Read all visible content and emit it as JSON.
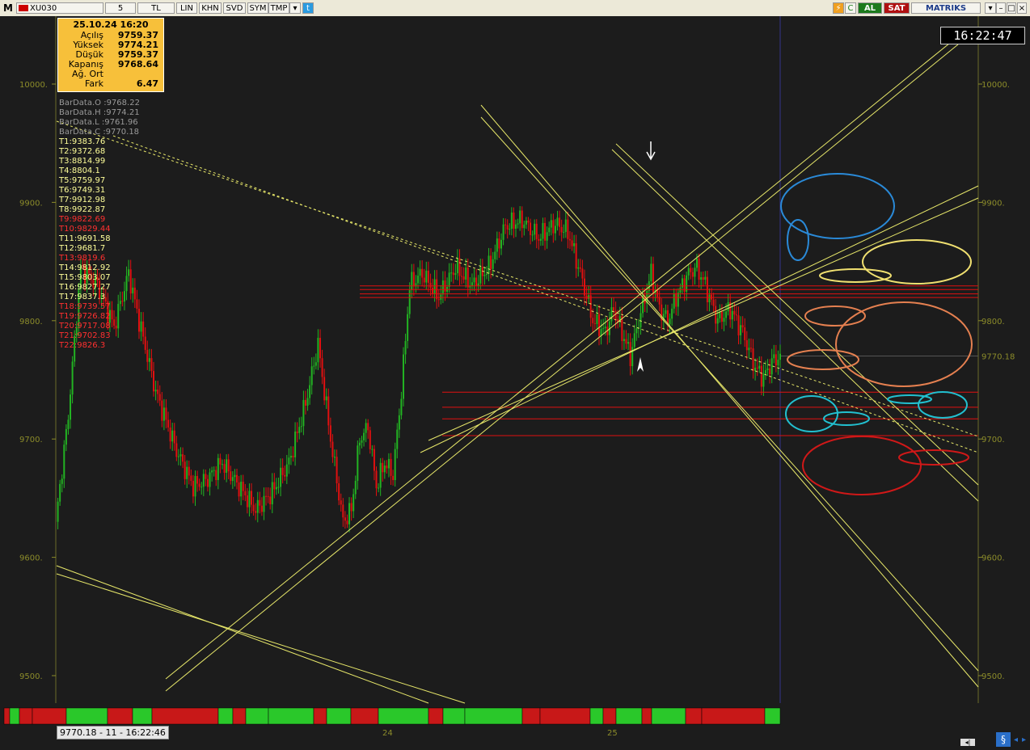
{
  "toolbar": {
    "logo": "M",
    "symbol": "XU030",
    "period": "5",
    "currency": "TL",
    "buttons": [
      "LIN",
      "KHN",
      "SVD",
      "SYM",
      "TMP"
    ],
    "buy_label": "AL",
    "sell_label": "SAT",
    "brand": "MATRIKS"
  },
  "clock": "16:22:47",
  "ohlc": {
    "datetime": "25.10.24 16:20",
    "rows": [
      {
        "label": "Açılış",
        "value": "9759.37"
      },
      {
        "label": "Yüksek",
        "value": "9774.21"
      },
      {
        "label": "Düşük",
        "value": "9759.37"
      },
      {
        "label": "Kapanış",
        "value": "9768.64"
      },
      {
        "label": "Ağ. Ort",
        "value": ""
      },
      {
        "label": "Fark",
        "value": "6.47"
      }
    ]
  },
  "bardata": [
    "BarData.O :9768.22",
    "BarData.H :9774.21",
    "BarData.L :9761.96",
    "BarData.C :9770.18"
  ],
  "levels": [
    {
      "text": "T1:9383.76",
      "color": "#ffff99"
    },
    {
      "text": "T2:9372.68",
      "color": "#ffff99"
    },
    {
      "text": "T3:8814.99",
      "color": "#ffff99"
    },
    {
      "text": "T4:8804.1",
      "color": "#ffff99"
    },
    {
      "text": "T5:9759.97",
      "color": "#ffff99"
    },
    {
      "text": "T6:9749.31",
      "color": "#ffff99"
    },
    {
      "text": "T7:9912.98",
      "color": "#ffff99"
    },
    {
      "text": "T8:9922.87",
      "color": "#ffff99"
    },
    {
      "text": "T9:9822.69",
      "color": "#ff3030"
    },
    {
      "text": "T10:9829.44",
      "color": "#ff3030"
    },
    {
      "text": "T11:9691.58",
      "color": "#ffff99"
    },
    {
      "text": "T12:9681.7",
      "color": "#ffff99"
    },
    {
      "text": "T13:9819.6",
      "color": "#ff3030"
    },
    {
      "text": "T14:9812.92",
      "color": "#ffff99"
    },
    {
      "text": "T15:9803.07",
      "color": "#ffff99"
    },
    {
      "text": "T16:9827.27",
      "color": "#ffff99"
    },
    {
      "text": "T17:9837.3",
      "color": "#ffff99"
    },
    {
      "text": "T18:9739.57",
      "color": "#ff3030"
    },
    {
      "text": "T19:9726.82",
      "color": "#ff3030"
    },
    {
      "text": "T20:9717.08",
      "color": "#ff3030"
    },
    {
      "text": "T21:9702.83",
      "color": "#ff3030"
    },
    {
      "text": "T22:9826.3",
      "color": "#ff3030"
    }
  ],
  "chart_data": {
    "type": "candlestick",
    "yticks": [
      "10000.",
      "9900.",
      "9800.",
      "9700.",
      "9600.",
      "9500."
    ],
    "ytick_values": [
      10000,
      9900,
      9800,
      9700,
      9600,
      9500
    ],
    "ylim": [
      9480,
      10070
    ],
    "last_price_label": "9770.18",
    "last_price": 9770.18,
    "xlabels": [
      "24",
      "25"
    ],
    "close_path": [
      [
        0,
        9630
      ],
      [
        6,
        9720
      ],
      [
        12,
        9845
      ],
      [
        20,
        9830
      ],
      [
        28,
        9795
      ],
      [
        35,
        9840
      ],
      [
        40,
        9800
      ],
      [
        48,
        9740
      ],
      [
        58,
        9690
      ],
      [
        66,
        9660
      ],
      [
        72,
        9665
      ],
      [
        80,
        9680
      ],
      [
        88,
        9660
      ],
      [
        96,
        9640
      ],
      [
        104,
        9655
      ],
      [
        112,
        9680
      ],
      [
        120,
        9730
      ],
      [
        126,
        9780
      ],
      [
        132,
        9700
      ],
      [
        138,
        9630
      ],
      [
        142,
        9640
      ],
      [
        146,
        9700
      ],
      [
        150,
        9710
      ],
      [
        154,
        9660
      ],
      [
        158,
        9680
      ],
      [
        162,
        9670
      ],
      [
        166,
        9740
      ],
      [
        170,
        9830
      ],
      [
        176,
        9840
      ],
      [
        184,
        9820
      ],
      [
        192,
        9845
      ],
      [
        200,
        9830
      ],
      [
        208,
        9845
      ],
      [
        216,
        9880
      ],
      [
        224,
        9885
      ],
      [
        232,
        9870
      ],
      [
        240,
        9882
      ],
      [
        246,
        9875
      ],
      [
        252,
        9840
      ],
      [
        258,
        9800
      ],
      [
        264,
        9790
      ],
      [
        268,
        9810
      ],
      [
        272,
        9790
      ],
      [
        276,
        9770
      ],
      [
        280,
        9800
      ],
      [
        286,
        9840
      ],
      [
        290,
        9810
      ],
      [
        294,
        9800
      ],
      [
        298,
        9820
      ],
      [
        304,
        9840
      ],
      [
        308,
        9845
      ],
      [
        312,
        9830
      ],
      [
        318,
        9800
      ],
      [
        324,
        9810
      ],
      [
        330,
        9790
      ],
      [
        336,
        9760
      ],
      [
        340,
        9752
      ],
      [
        344,
        9765
      ],
      [
        348,
        9770
      ]
    ],
    "support_resistance": [
      9829.44,
      9826.3,
      9822.69,
      9819.6,
      9739.57,
      9726.82,
      9717.08,
      9702.83
    ]
  }
}
